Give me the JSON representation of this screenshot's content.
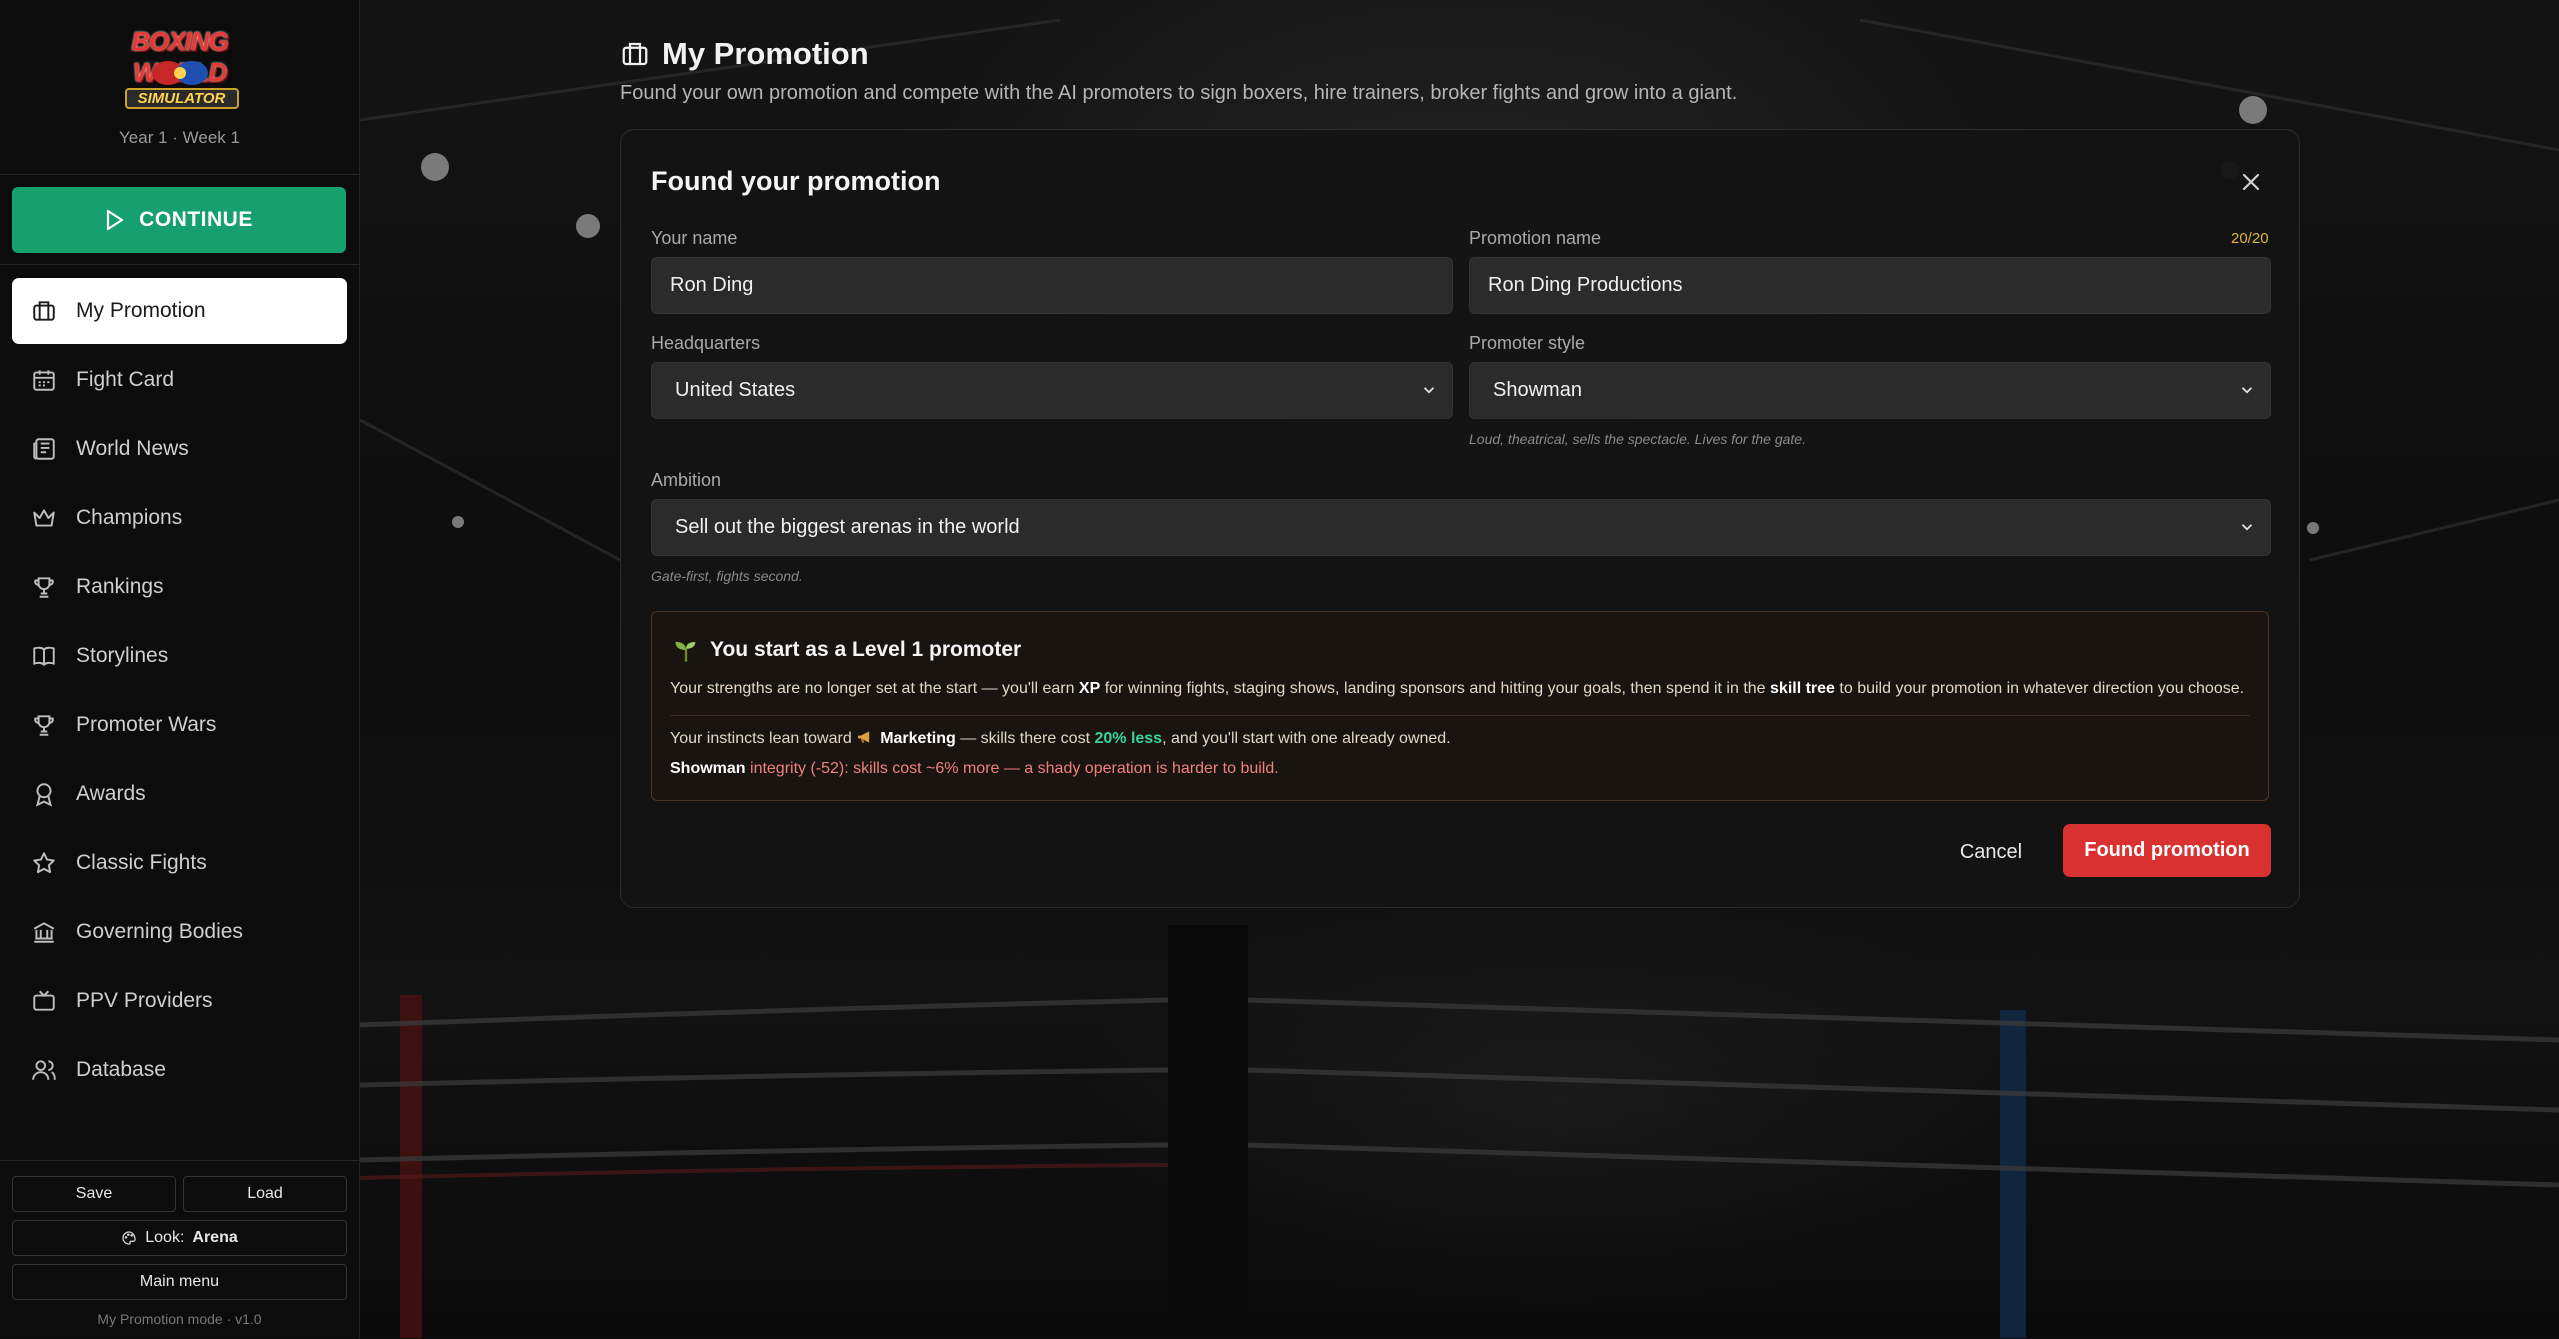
{
  "app": {
    "logo_line1": "BOXING WORLD",
    "logo_line2": "SIMULATOR",
    "date": "Year 1 · Week 1"
  },
  "sidebar": {
    "continue_label": "CONTINUE",
    "items": [
      {
        "label": "My Promotion",
        "icon": "briefcase-icon",
        "active": true
      },
      {
        "label": "Fight Card",
        "icon": "calendar-icon"
      },
      {
        "label": "World News",
        "icon": "newspaper-icon"
      },
      {
        "label": "Champions",
        "icon": "crown-icon"
      },
      {
        "label": "Rankings",
        "icon": "trophy-icon"
      },
      {
        "label": "Storylines",
        "icon": "book-icon"
      },
      {
        "label": "Promoter Wars",
        "icon": "trophy-icon"
      },
      {
        "label": "Awards",
        "icon": "award-icon"
      },
      {
        "label": "Classic Fights",
        "icon": "star-icon"
      },
      {
        "label": "Governing Bodies",
        "icon": "bank-icon"
      },
      {
        "label": "PPV Providers",
        "icon": "tv-icon"
      },
      {
        "label": "Database",
        "icon": "users-icon"
      }
    ],
    "save_label": "Save",
    "load_label": "Load",
    "look_label": "Look:",
    "look_value": "Arena",
    "main_menu_label": "Main menu",
    "mode_text": "My Promotion mode · v1.0"
  },
  "page": {
    "title": "My Promotion",
    "subtitle": "Found your own promotion and compete with the AI promoters to sign boxers, hire trainers, broker fights and grow into a giant."
  },
  "modal": {
    "title": "Found your promotion",
    "your_name_label": "Your name",
    "your_name_value": "Ron Ding",
    "promotion_name_label": "Promotion name",
    "promotion_name_value": "Ron Ding Productions",
    "promotion_name_counter": "20/20",
    "hq_label": "Headquarters",
    "hq_value": "United States",
    "style_label": "Promoter style",
    "style_value": "Showman",
    "style_hint": "Loud, theatrical, sells the spectacle. Lives for the gate.",
    "ambition_label": "Ambition",
    "ambition_value": "Sell out the biggest arenas in the world",
    "ambition_hint": "Gate-first, fights second.",
    "info": {
      "title": "You start as a Level 1 promoter",
      "p1_a": "Your strengths are no longer set at the start — you'll earn ",
      "p1_xp": "XP",
      "p1_b": " for winning fights, staging shows, landing sponsors and hitting your goals, then spend it in the ",
      "p1_tree": "skill tree",
      "p1_c": " to build your promotion in whatever direction you choose.",
      "p2_a": "Your instincts lean toward ",
      "p2_skill": "Marketing",
      "p2_b": " — skills there cost ",
      "p2_pct": "20% less",
      "p2_c": ", and you'll start with one already owned.",
      "p3_style": "Showman",
      "p3_rest": " integrity (-52): skills cost ~6% more — a shady operation is harder to build."
    },
    "cancel_label": "Cancel",
    "submit_label": "Found promotion"
  },
  "colors": {
    "accent_green": "#16a06d",
    "accent_red": "#d93030",
    "counter_gold": "#e2b43b"
  }
}
